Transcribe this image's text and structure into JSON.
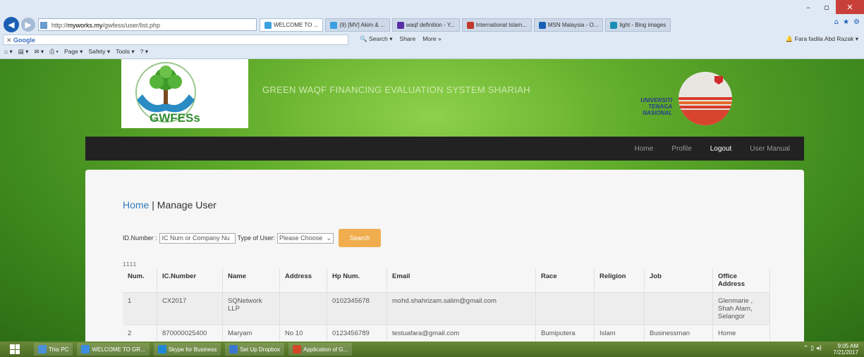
{
  "browser": {
    "address_prefix": "http://",
    "address_host": "myworks.my",
    "address_path": "/gwfess/user/list.php",
    "tabs": [
      {
        "label": "WELCOME TO ...",
        "active": true,
        "color": "#3aa0e0"
      },
      {
        "label": "(9) [MV] Akim & ...",
        "active": false,
        "color": "#3aa0e0"
      },
      {
        "label": "waqf definition - Y...",
        "active": false,
        "color": "#5a2ea6"
      },
      {
        "label": "International Islam...",
        "active": false,
        "color": "#c0392b"
      },
      {
        "label": "MSN Malaysia - O...",
        "active": false,
        "color": "#1a5fb4"
      },
      {
        "label": "light - Bing images",
        "active": false,
        "color": "#1a8fb4"
      }
    ],
    "google_label": "Google",
    "toolbar": {
      "search": "Search",
      "share": "Share",
      "more": "More »"
    },
    "user": "Fara fadila Abd Razak",
    "commands": {
      "page": "Page",
      "safety": "Safety",
      "tools": "Tools"
    }
  },
  "header": {
    "logo_text": "GWFESs",
    "title": "GREEN WAQF FINANCING EVALUATION SYSTEM SHARIAH",
    "uniten_lines": [
      "UNIVERSITI",
      "TENAGA",
      "NASIONAL"
    ]
  },
  "nav": {
    "home": "Home",
    "profile": "Profile",
    "logout": "Logout",
    "manual": "User Manual"
  },
  "breadcrumb": {
    "home": "Home",
    "separator": " | ",
    "current": "Manage User"
  },
  "filter": {
    "id_label": "ID.Number :",
    "id_placeholder": "IC Num  or Company Nu",
    "type_label": "Type of User:",
    "type_selected": "Please Choose",
    "search_button": "Search"
  },
  "pagination": "1111",
  "table": {
    "headers": [
      "Num.",
      "IC.Number",
      "Name",
      "Address",
      "Hp Num.",
      "Email",
      "Race",
      "Religion",
      "Job",
      "Office Address"
    ],
    "rows": [
      [
        "1",
        "CX2017",
        "SQNetwork LLP",
        "",
        "0102345678",
        "mohd.shahrizam.salim@gmail.com",
        "",
        "",
        "",
        "Glenmarie , Shah Alam, Selangor"
      ],
      [
        "2",
        "870000025400",
        "Maryam",
        "No 10",
        "0123456789",
        "testuafara@gmail.com",
        "Bumiputera",
        "Islam",
        "Businessman",
        "Home"
      ]
    ]
  },
  "taskbar": {
    "items": [
      "This PC",
      "WELCOME TO GR...",
      "Skype for Business",
      "Set Up Dropbox",
      "Application of G..."
    ],
    "time": "9:05 AM",
    "date": "7/21/2017"
  }
}
